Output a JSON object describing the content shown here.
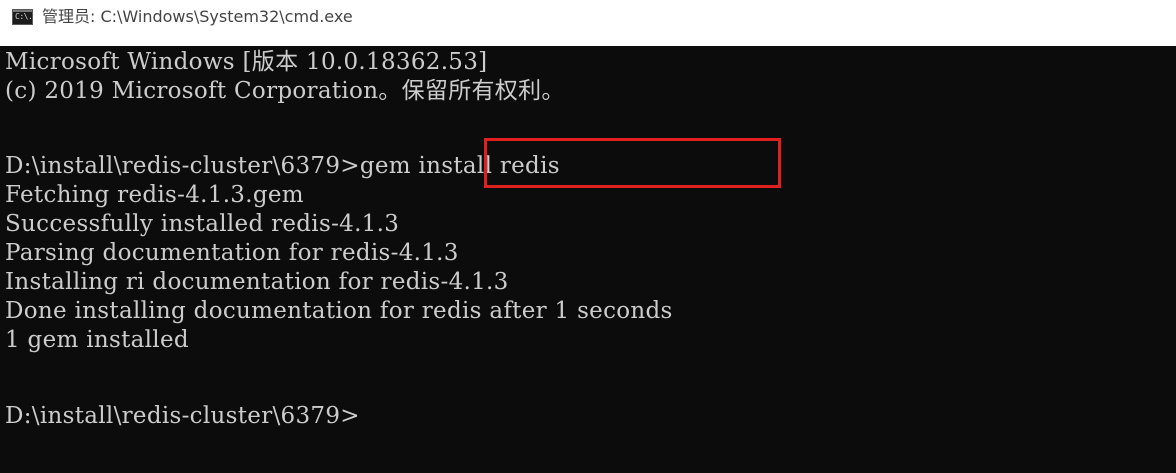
{
  "window": {
    "title": "管理员: C:\\Windows\\System32\\cmd.exe",
    "icon": "cmd-icon",
    "icon_text": "C:\\."
  },
  "console": {
    "lines": [
      "Microsoft Windows [版本 10.0.18362.53]",
      "(c) 2019 Microsoft Corporation。保留所有权利。",
      "",
      "",
      "Fetching redis-4.1.3.gem",
      "Successfully installed redis-4.1.3",
      "Parsing documentation for redis-4.1.3",
      "Installing ri documentation for redis-4.1.3",
      "Done installing documentation for redis after 1 seconds",
      "1 gem installed",
      "",
      "D:\\install\\redis-cluster\\6379>"
    ],
    "prompt_path": "D:\\install\\redis-cluster\\6379>",
    "command": "gem install redis",
    "highlight_color": "#e01f1f",
    "background_color": "#0c0c0c",
    "text_color": "#cccccc"
  }
}
